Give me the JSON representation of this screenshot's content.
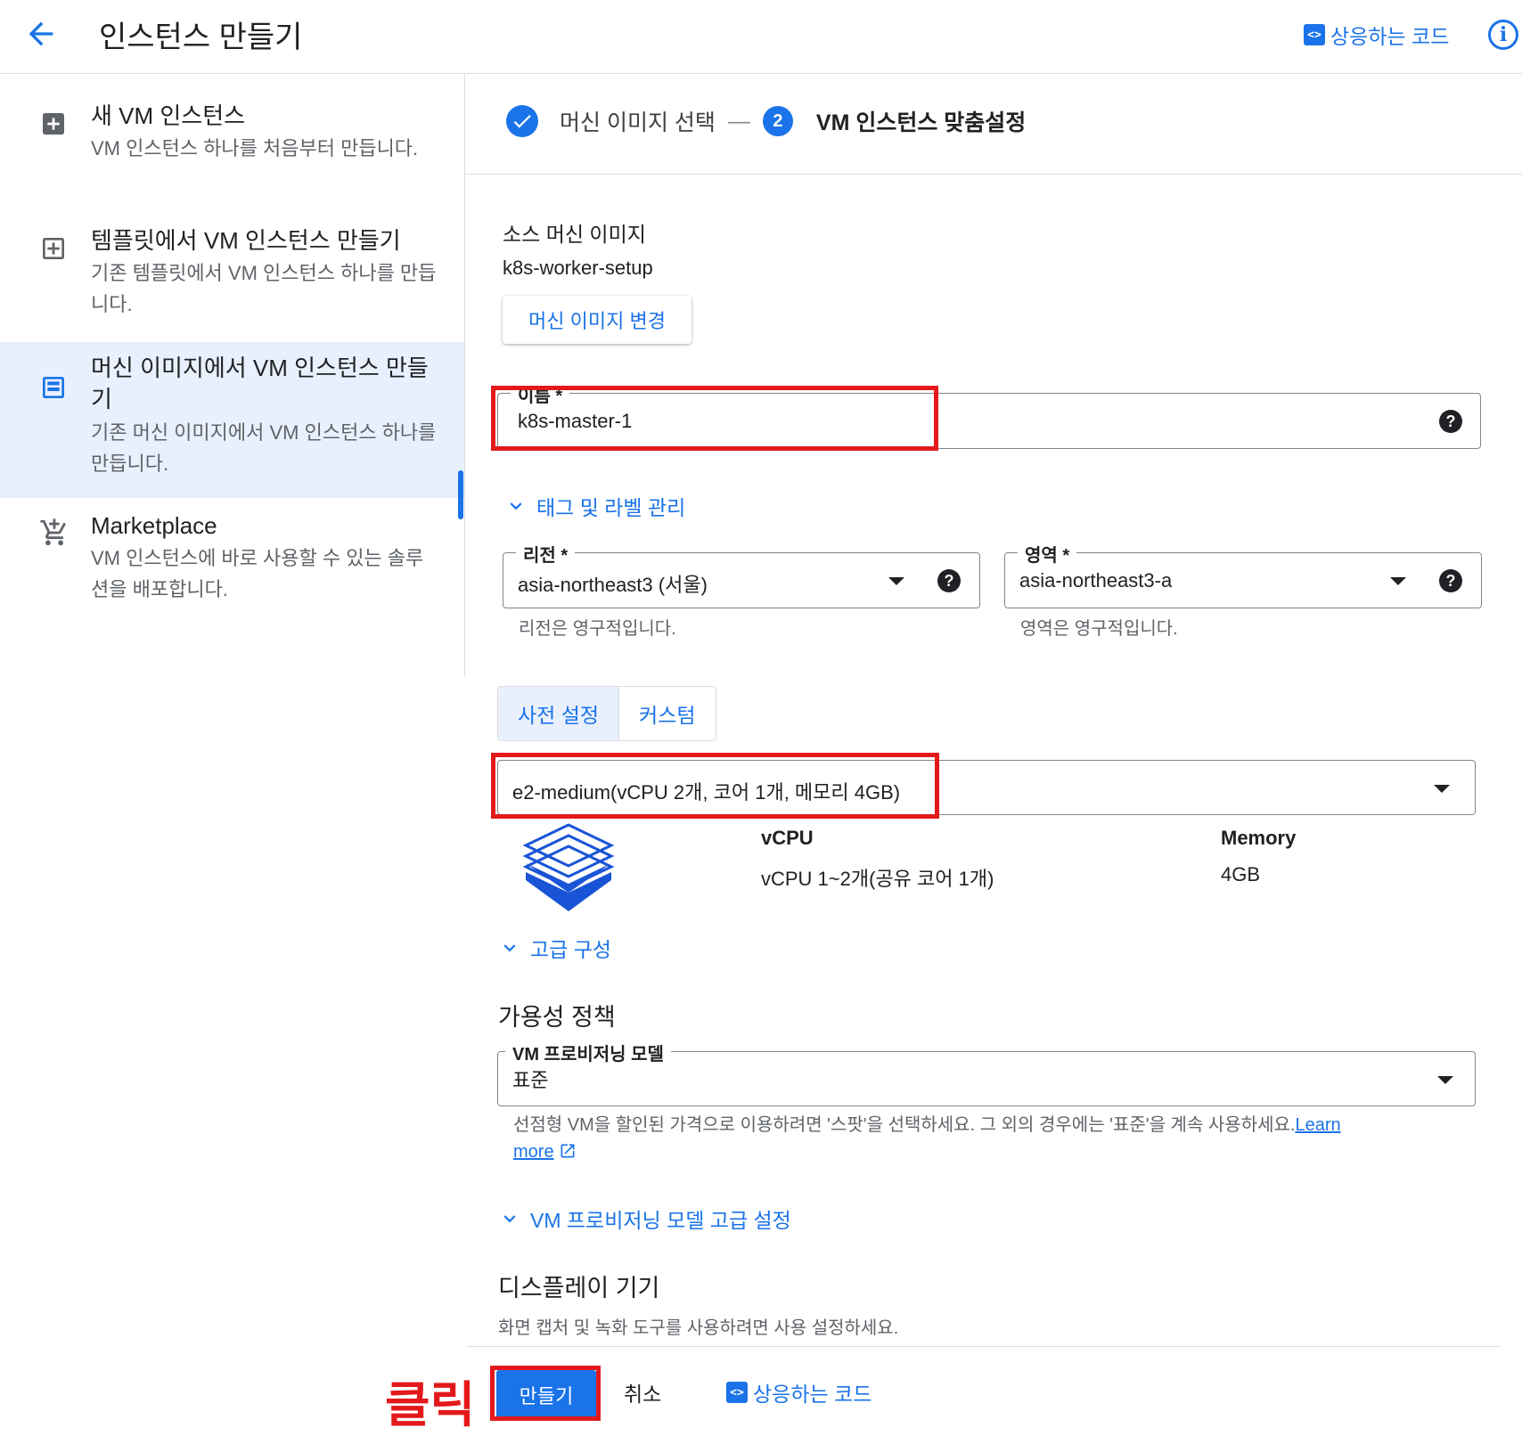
{
  "header": {
    "title": "인스턴스 만들기",
    "equivalent_code": "상응하는 코드"
  },
  "sidebar": {
    "items": [
      {
        "title": "새 VM 인스턴스",
        "desc": "VM 인스턴스 하나를 처음부터 만듭니다."
      },
      {
        "title": "템플릿에서 VM 인스턴스 만들기",
        "desc": "기존 템플릿에서 VM 인스턴스 하나를 만듭니다."
      },
      {
        "title": "머신 이미지에서 VM 인스턴스 만들기",
        "desc": "기존 머신 이미지에서 VM 인스턴스 하나를 만듭니다."
      },
      {
        "title": "Marketplace",
        "desc": "VM 인스턴스에 바로 사용할 수 있는 솔루션을 배포합니다."
      }
    ]
  },
  "stepper": {
    "step1": "머신 이미지 선택",
    "sep": "—",
    "step2_num": "2",
    "step2": "VM 인스턴스 맞춤설정"
  },
  "source": {
    "label": "소스 머신 이미지",
    "value": "k8s-worker-setup",
    "change_button": "머신 이미지 변경"
  },
  "name_field": {
    "label": "이름 *",
    "value": "k8s-master-1"
  },
  "tags_link": "태그 및 라벨 관리",
  "region": {
    "label": "리전 *",
    "value": "asia-northeast3 (서울)",
    "hint": "리전은 영구적입니다."
  },
  "zone": {
    "label": "영역 *",
    "value": "asia-northeast3-a",
    "hint": "영역은 영구적입니다."
  },
  "machine_tabs": {
    "preset": "사전 설정",
    "custom": "커스텀"
  },
  "machine_type": {
    "value": "e2-medium(vCPU 2개, 코어 1개, 메모리 4GB)"
  },
  "specs": {
    "vcpu_header": "vCPU",
    "vcpu_value": "vCPU 1~2개(공유 코어 1개)",
    "mem_header": "Memory",
    "mem_value": "4GB"
  },
  "advanced_link": "고급 구성",
  "availability": {
    "title": "가용성 정책",
    "model_label": "VM 프로비저닝 모델",
    "model_value": "표준",
    "hint": "선점형 VM을 할인된 가격으로 이용하려면 '스팟'을 선택하세요. 그 외의 경우에는 '표준'을 계속 사용하세요.",
    "learn_1": "Learn",
    "learn_2": "more",
    "advanced_link": "VM 프로비저닝 모델 고급 설정"
  },
  "display": {
    "title": "디스플레이 기기",
    "desc": "화면 캡처 및 녹화 도구를 사용하려면 사용 설정하세요."
  },
  "footer": {
    "create": "만들기",
    "cancel": "취소",
    "equivalent_code": "상응하는 코드"
  },
  "annotation": {
    "click": "클릭"
  },
  "colors": {
    "accent": "#1a73e8",
    "highlight": "#e3191b",
    "active_bg": "#e8f0fe"
  }
}
